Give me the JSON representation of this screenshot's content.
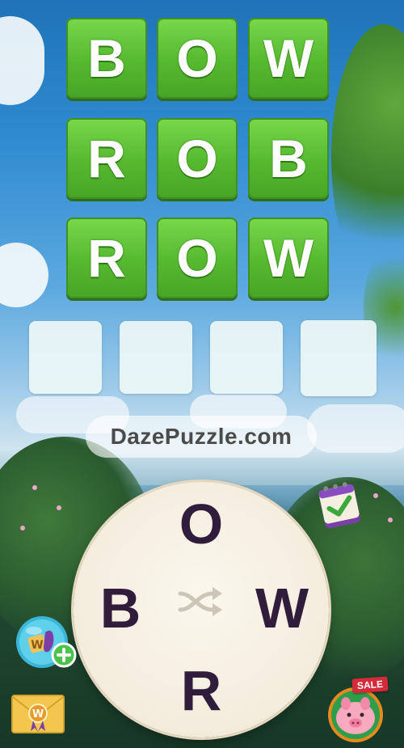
{
  "board": {
    "rows": [
      [
        "B",
        "O",
        "W"
      ],
      [
        "R",
        "O",
        "B"
      ],
      [
        "R",
        "O",
        "W"
      ]
    ],
    "empty_slots": 4
  },
  "watermark": "DazePuzzle.com",
  "wheel": {
    "letters": {
      "top": "O",
      "left": "B",
      "right": "W",
      "bottom": "R"
    }
  },
  "icons": {
    "shuffle": "shuffle-icon",
    "daily": "calendar-check-icon",
    "hint": "hint-booster-icon",
    "mail": "envelope-icon",
    "shop": "piggy-bank-icon"
  },
  "shop": {
    "badge": "SALE"
  },
  "colors": {
    "tile_green": "#55b92f",
    "wheel_letter": "#2f1d3b",
    "sale_red": "#d42a3a"
  }
}
